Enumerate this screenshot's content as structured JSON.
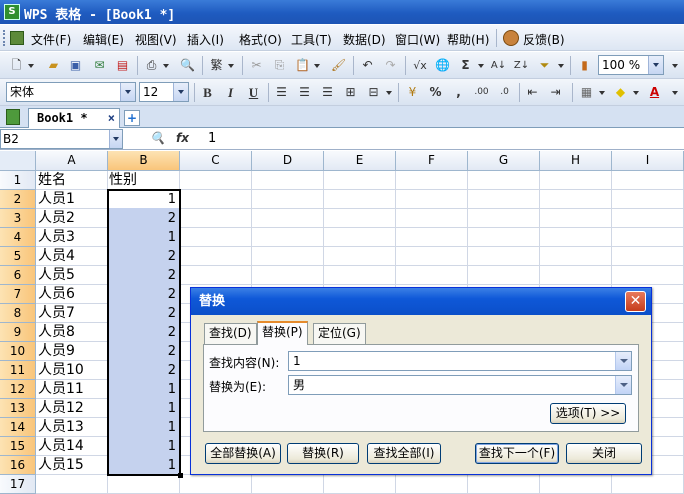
{
  "window": {
    "title": "WPS 表格 - [Book1 *]"
  },
  "menu": {
    "items": [
      "文件(F)",
      "编辑(E)",
      "视图(V)",
      "插入(I)",
      "格式(O)",
      "工具(T)",
      "数据(D)",
      "窗口(W)",
      "帮助(H)"
    ],
    "feedback": "反馈(B)"
  },
  "toolbar": {
    "zoom": "100 %",
    "font_name": "宋体",
    "font_size": "12",
    "bold_label": "B",
    "italic_label": "I",
    "underline_label": "U"
  },
  "tabs": {
    "document": "Book1 *"
  },
  "formula_bar": {
    "cell_ref": "B2",
    "value": "1"
  },
  "sheet": {
    "columns": [
      "A",
      "B",
      "C",
      "D",
      "E",
      "F",
      "G",
      "H",
      "I"
    ],
    "row_numbers": [
      "1",
      "2",
      "3",
      "4",
      "5",
      "6",
      "7",
      "8",
      "9",
      "10",
      "11",
      "12",
      "13",
      "14",
      "15",
      "16",
      "17"
    ],
    "header": {
      "a": "姓名",
      "b": "性别"
    },
    "rows": [
      {
        "a": "人员1",
        "b": "1"
      },
      {
        "a": "人员2",
        "b": "2"
      },
      {
        "a": "人员3",
        "b": "1"
      },
      {
        "a": "人员4",
        "b": "2"
      },
      {
        "a": "人员5",
        "b": "2"
      },
      {
        "a": "人员6",
        "b": "2"
      },
      {
        "a": "人员7",
        "b": "2"
      },
      {
        "a": "人员8",
        "b": "2"
      },
      {
        "a": "人员9",
        "b": "2"
      },
      {
        "a": "人员10",
        "b": "2"
      },
      {
        "a": "人员11",
        "b": "1"
      },
      {
        "a": "人员12",
        "b": "1"
      },
      {
        "a": "人员13",
        "b": "1"
      },
      {
        "a": "人员14",
        "b": "1"
      },
      {
        "a": "人员15",
        "b": "1"
      }
    ]
  },
  "dialog": {
    "title": "替换",
    "tabs": [
      "查找(D)",
      "替换(P)",
      "定位(G)"
    ],
    "find_label": "查找内容(N):",
    "find_value": "1",
    "replace_label": "替换为(E):",
    "replace_value": "男",
    "options_button": "选项(T) >>",
    "buttons": {
      "replace_all": "全部替换(A)",
      "replace": "替换(R)",
      "find_all": "查找全部(I)",
      "find_next": "查找下一个(F)",
      "close": "关闭"
    }
  }
}
